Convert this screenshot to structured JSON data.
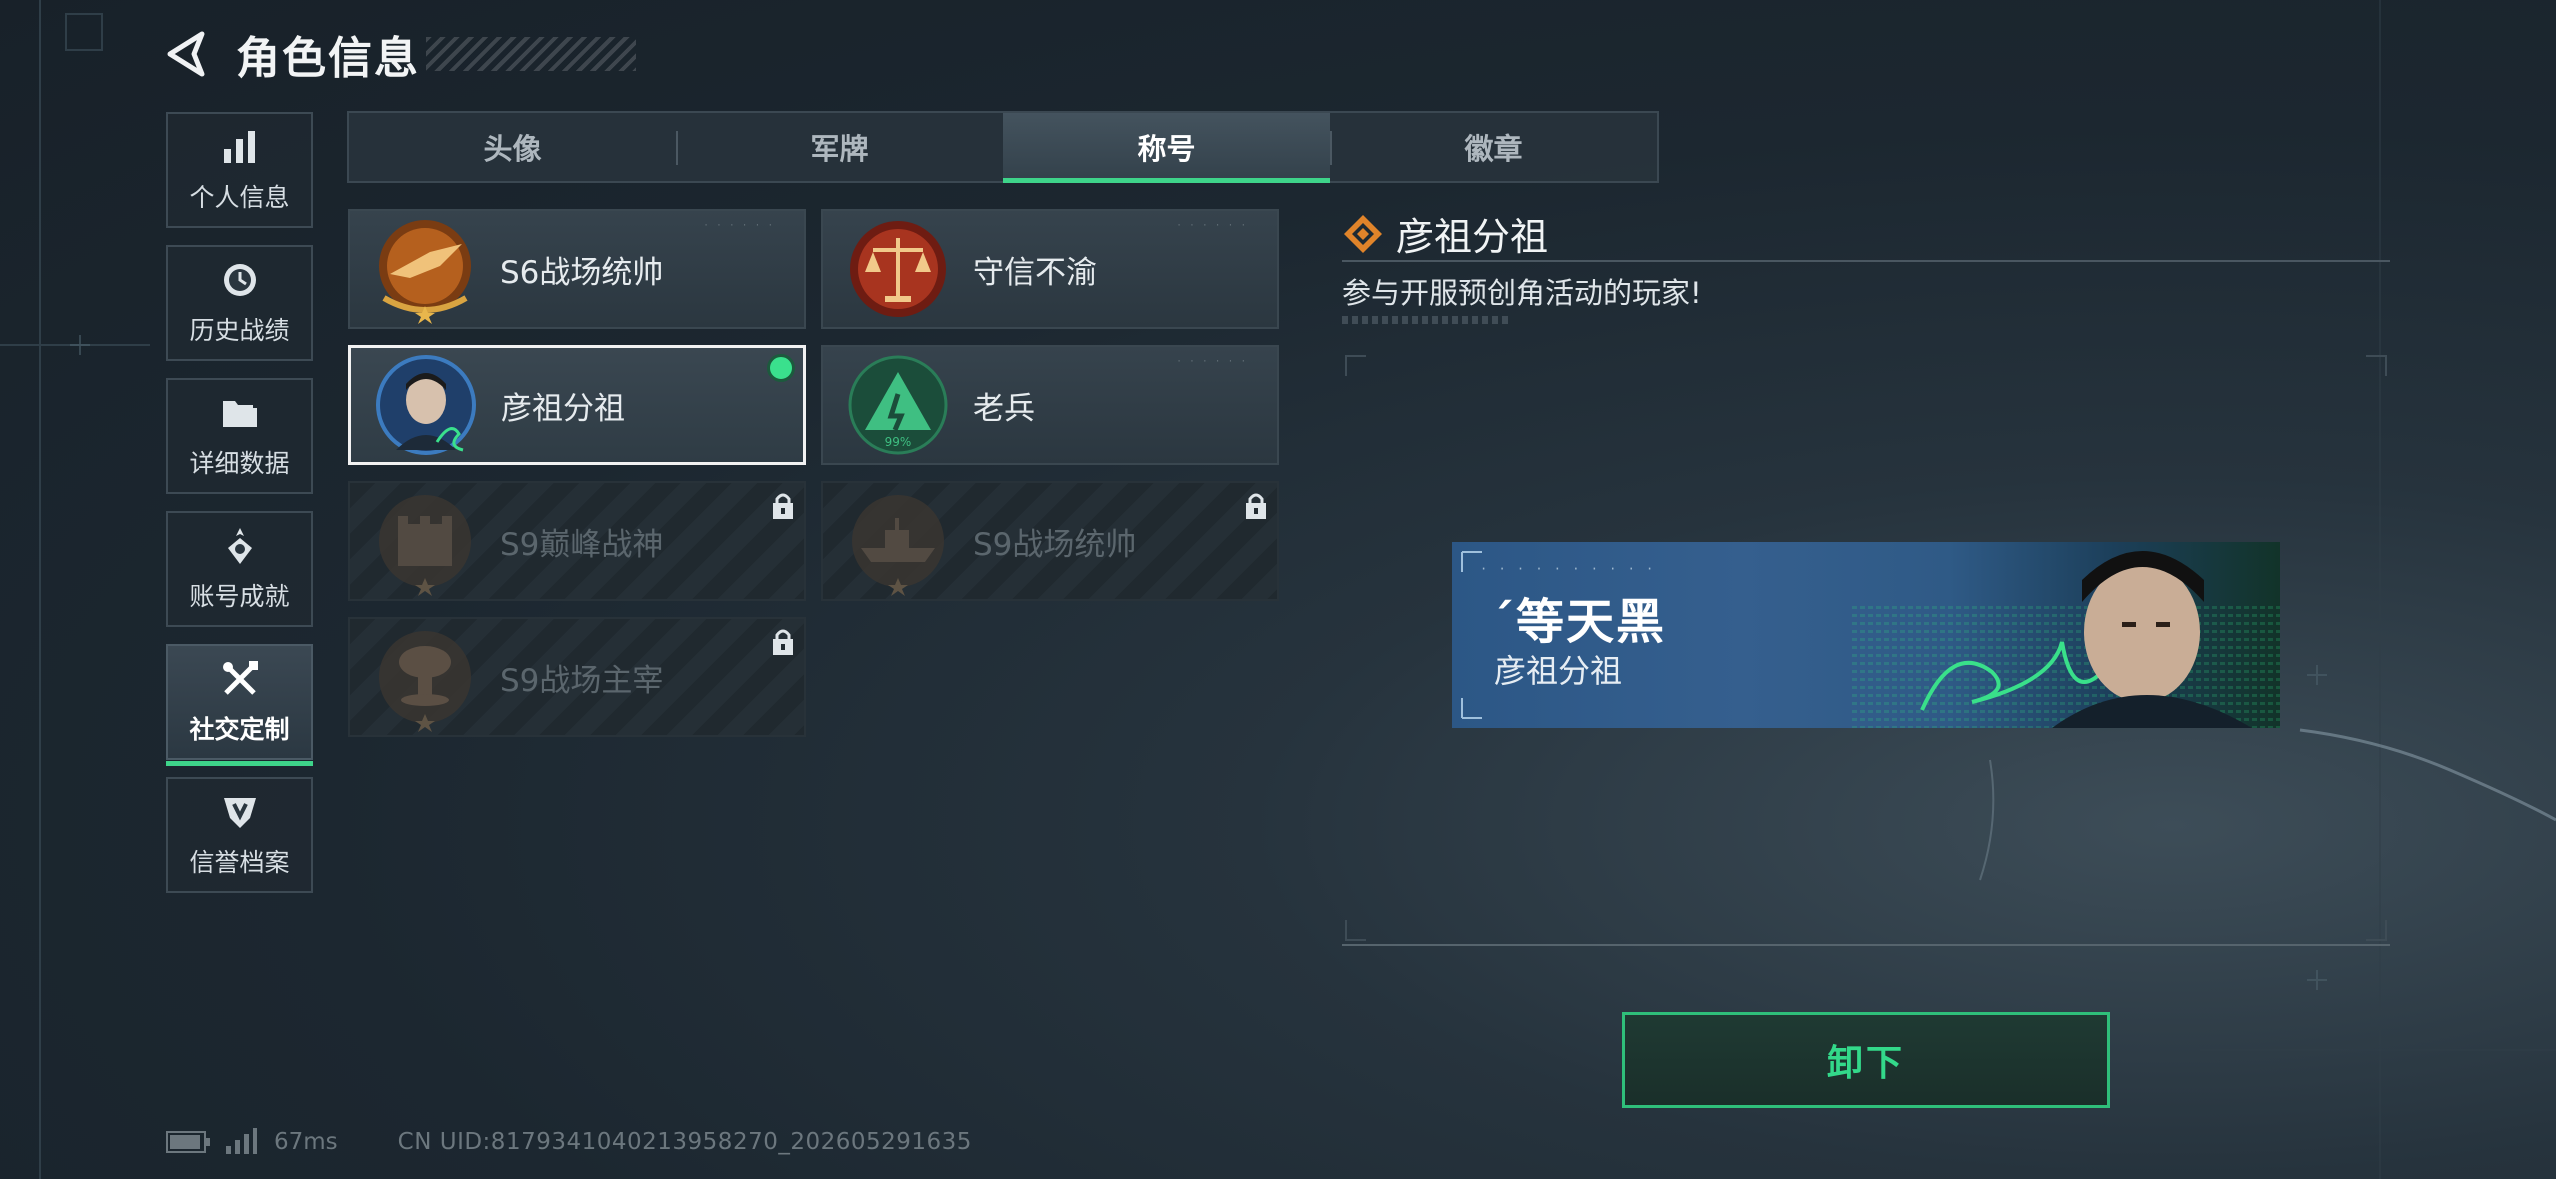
{
  "header": {
    "title": "角色信息"
  },
  "sidebar": {
    "items": [
      {
        "label": "个人信息",
        "icon": "bar-chart-icon",
        "active": false
      },
      {
        "label": "历史战绩",
        "icon": "history-clock-icon",
        "active": false
      },
      {
        "label": "详细数据",
        "icon": "folder-icon",
        "active": false
      },
      {
        "label": "账号成就",
        "icon": "achievement-icon",
        "active": false
      },
      {
        "label": "社交定制",
        "icon": "tools-icon",
        "active": true
      },
      {
        "label": "信誉档案",
        "icon": "credit-shield-icon",
        "active": false
      }
    ]
  },
  "tabs": [
    {
      "label": "头像",
      "active": false
    },
    {
      "label": "军牌",
      "active": false
    },
    {
      "label": "称号",
      "active": true
    },
    {
      "label": "徽章",
      "active": false
    }
  ],
  "titles": [
    {
      "name": "S6战场统帅",
      "emblem": "fighter-jet-emblem-icon",
      "state": "owned"
    },
    {
      "name": "守信不渝",
      "emblem": "scales-emblem-icon",
      "state": "owned"
    },
    {
      "name": "彦祖分祖",
      "emblem": "portrait-emblem-icon",
      "state": "equipped"
    },
    {
      "name": "老兵",
      "emblem": "veteran-emblem-icon",
      "state": "owned"
    },
    {
      "name": "S9巅峰战神",
      "emblem": "fortress-emblem-icon",
      "state": "locked"
    },
    {
      "name": "S9战场统帅",
      "emblem": "warship-emblem-icon",
      "state": "locked"
    },
    {
      "name": "S9战场主宰",
      "emblem": "mushroom-cloud-emblem-icon",
      "state": "locked"
    }
  ],
  "veteran_badge_text": "99%",
  "detail": {
    "name": "彦祖分祖",
    "description": "参与开服预创角活动的玩家!",
    "banner": {
      "player_name": "´等天黑",
      "title": "彦祖分祖"
    },
    "action_label": "卸下"
  },
  "status": {
    "ping": "67ms",
    "uid": "CN UID:8179341040213958270_202605291635"
  },
  "colors": {
    "accent": "#3ed48a",
    "background": "#1c2730",
    "locked_text": "#5b666d"
  }
}
